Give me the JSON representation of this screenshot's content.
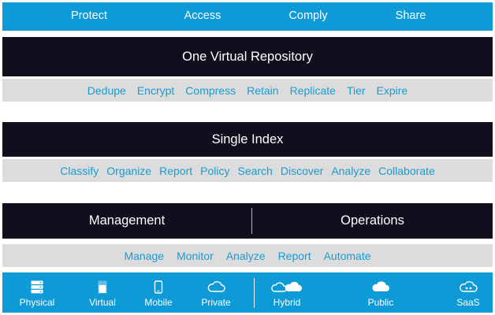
{
  "top_bar": [
    "Protect",
    "Access",
    "Comply",
    "Share"
  ],
  "repository": {
    "title": "One Virtual Repository",
    "capabilities": [
      "Dedupe",
      "Encrypt",
      "Compress",
      "Retain",
      "Replicate",
      "Tier",
      "Expire"
    ]
  },
  "index": {
    "title": "Single Index",
    "capabilities": [
      "Classify",
      "Organize",
      "Report",
      "Policy",
      "Search",
      "Discover",
      "Analyze",
      "Collaborate"
    ]
  },
  "management": {
    "left_title": "Management",
    "right_title": "Operations",
    "capabilities": [
      "Manage",
      "Monitor",
      "Analyze",
      "Report",
      "Automate"
    ]
  },
  "environments": [
    {
      "label": "Physical",
      "icon": "server-icon"
    },
    {
      "label": "Virtual",
      "icon": "virtual-server-icon"
    },
    {
      "label": "Mobile",
      "icon": "mobile-icon"
    },
    {
      "label": "Private",
      "icon": "private-cloud-icon"
    },
    {
      "label": "Hybrid",
      "icon": "hybrid-cloud-icon"
    },
    {
      "label": "Public",
      "icon": "public-cloud-icon"
    },
    {
      "label": "SaaS",
      "icon": "saas-cloud-icon"
    }
  ],
  "colors": {
    "blue": "#0d9ad7",
    "dark": "#0f0f1e",
    "gray": "#dcdcdc",
    "blue_text": "#1a9bd2"
  }
}
